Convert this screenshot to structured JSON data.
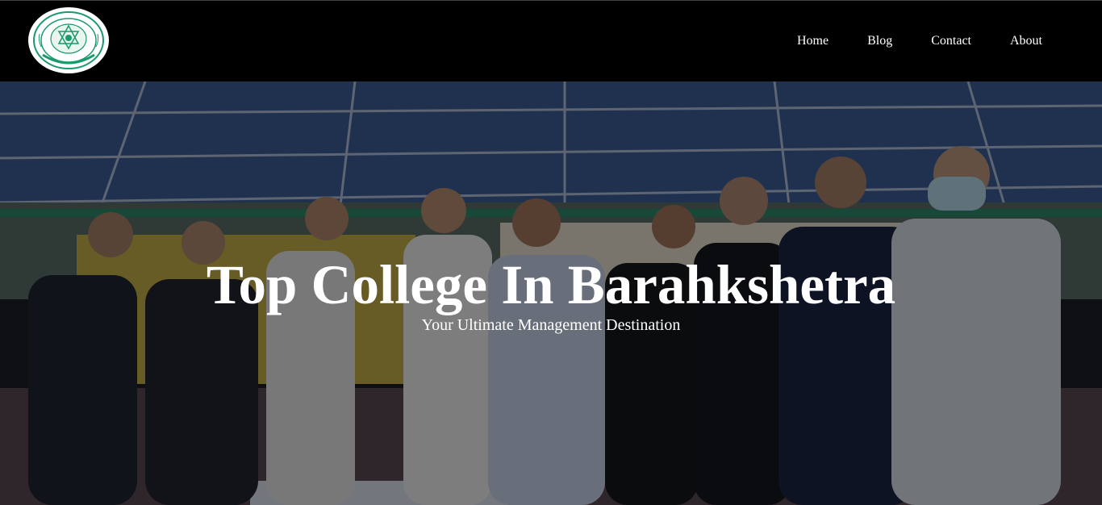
{
  "header": {
    "logo_icon": "college-seal-logo",
    "nav": [
      {
        "label": "Home"
      },
      {
        "label": "Blog"
      },
      {
        "label": "Contact"
      },
      {
        "label": "About"
      }
    ]
  },
  "hero": {
    "title": "Top College In Barahkshetra",
    "subtitle": "Your Ultimate Management Destination",
    "background": "group-photo-ceremony"
  },
  "colors": {
    "nav_bg": "#000000",
    "text": "#ffffff",
    "logo_accent": "#1a9a6a"
  }
}
